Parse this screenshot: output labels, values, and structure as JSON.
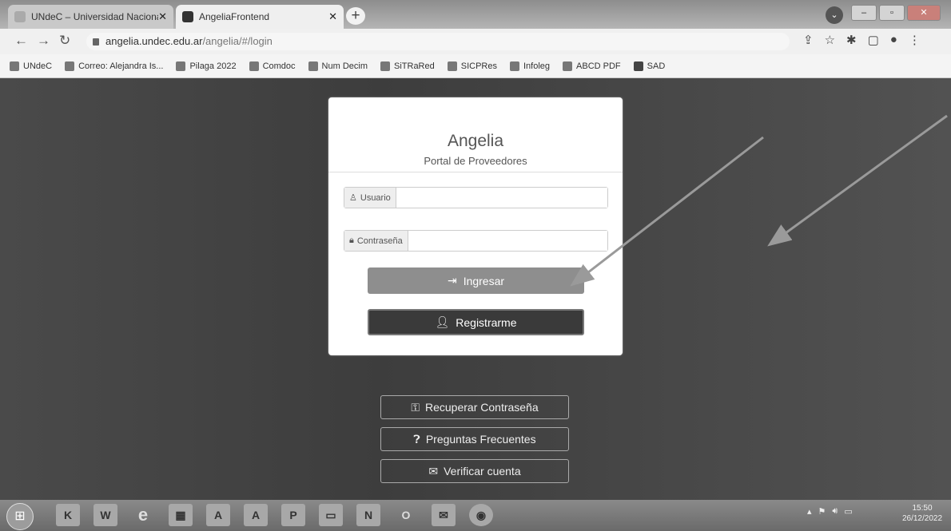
{
  "browser": {
    "tabs": [
      {
        "title": "UNdeC – Universidad Nacional d",
        "close": "✕"
      },
      {
        "title": "AngeliaFrontend",
        "close": "✕"
      }
    ],
    "new_tab": "+",
    "url_host": "angelia.undec.edu.ar",
    "url_path": "/angelia/#/login",
    "bookmarks": [
      "UNdeC",
      "Correo: Alejandra Is...",
      "Pilaga 2022",
      "Comdoc",
      "Num Decim",
      "SiTRaRed",
      "SICPRes",
      "Infoleg",
      "ABCD PDF",
      "SAD"
    ]
  },
  "login": {
    "title": "Angelia",
    "subtitle": "Portal de Proveedores",
    "username_label": "Usuario",
    "password_label": "Contraseña",
    "login_button": "Ingresar",
    "register_button": "Registrarme"
  },
  "links": {
    "recover": "Recuperar Contraseña",
    "faq": "Preguntas Frecuentes",
    "verify": "Verificar cuenta"
  },
  "taskbar": {
    "time": "15:50",
    "date": "26/12/2022"
  }
}
